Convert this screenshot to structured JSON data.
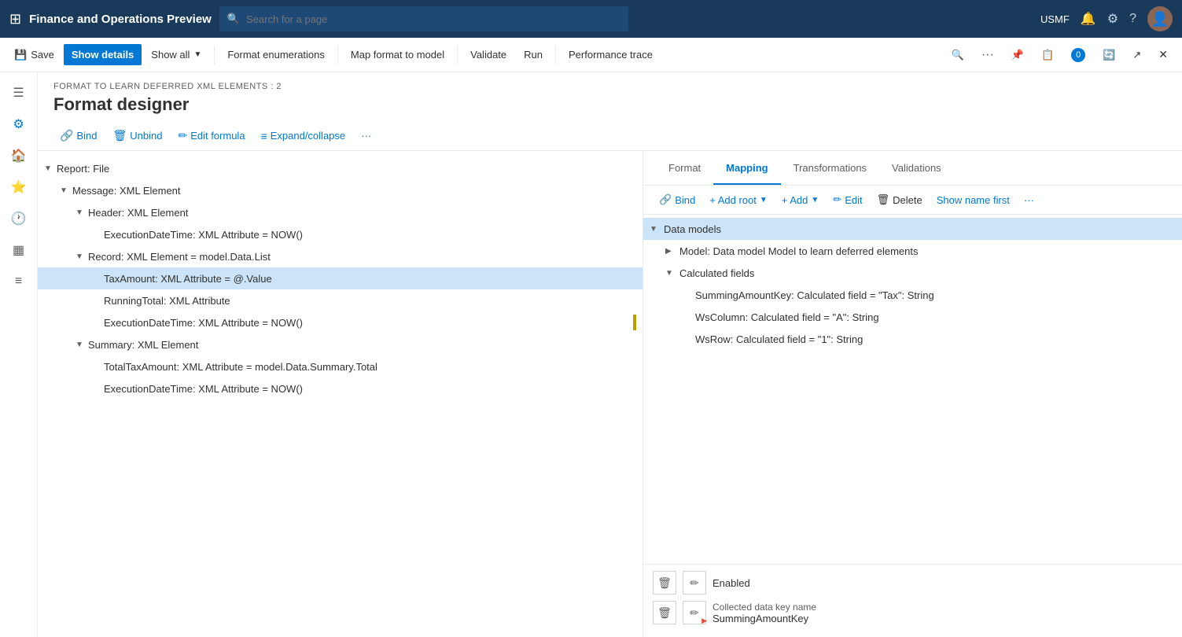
{
  "topbar": {
    "app_title": "Finance and Operations Preview",
    "search_placeholder": "Search for a page",
    "username": "USMF",
    "grid_icon": "⊞",
    "bell_icon": "🔔",
    "gear_icon": "⚙",
    "help_icon": "?",
    "avatar_text": "👤"
  },
  "commandbar": {
    "save_label": "Save",
    "show_details_label": "Show details",
    "show_all_label": "Show all",
    "format_enumerations_label": "Format enumerations",
    "map_format_label": "Map format to model",
    "validate_label": "Validate",
    "run_label": "Run",
    "performance_trace_label": "Performance trace"
  },
  "page": {
    "breadcrumb": "FORMAT TO LEARN DEFERRED XML ELEMENTS : 2",
    "title": "Format designer"
  },
  "designer_toolbar": {
    "bind_label": "Bind",
    "unbind_label": "Unbind",
    "edit_formula_label": "Edit formula",
    "expand_collapse_label": "Expand/collapse",
    "more_label": "···"
  },
  "format_tree": {
    "items": [
      {
        "id": "report-file",
        "indent": 0,
        "toggle": "▼",
        "label": "Report: File",
        "selected": false,
        "has_bar": false
      },
      {
        "id": "message-xml",
        "indent": 1,
        "toggle": "▼",
        "label": "Message: XML Element",
        "selected": false,
        "has_bar": false
      },
      {
        "id": "header-xml",
        "indent": 2,
        "toggle": "▼",
        "label": "Header: XML Element",
        "selected": false,
        "has_bar": false
      },
      {
        "id": "execution-datetime-1",
        "indent": 3,
        "toggle": "",
        "label": "ExecutionDateTime: XML Attribute = NOW()",
        "selected": false,
        "has_bar": false
      },
      {
        "id": "record-xml",
        "indent": 2,
        "toggle": "▼",
        "label": "Record: XML Element = model.Data.List",
        "selected": false,
        "has_bar": false
      },
      {
        "id": "taxamount",
        "indent": 3,
        "toggle": "",
        "label": "TaxAmount: XML Attribute = @.Value",
        "selected": true,
        "has_bar": false
      },
      {
        "id": "runningtotal",
        "indent": 3,
        "toggle": "",
        "label": "RunningTotal: XML Attribute",
        "selected": false,
        "has_bar": false
      },
      {
        "id": "execution-datetime-2",
        "indent": 3,
        "toggle": "",
        "label": "ExecutionDateTime: XML Attribute = NOW()",
        "selected": false,
        "has_bar": true
      },
      {
        "id": "summary-xml",
        "indent": 2,
        "toggle": "▼",
        "label": "Summary: XML Element",
        "selected": false,
        "has_bar": false
      },
      {
        "id": "totaltaxamount",
        "indent": 3,
        "toggle": "",
        "label": "TotalTaxAmount: XML Attribute = model.Data.Summary.Total",
        "selected": false,
        "has_bar": false
      },
      {
        "id": "execution-datetime-3",
        "indent": 3,
        "toggle": "",
        "label": "ExecutionDateTime: XML Attribute = NOW()",
        "selected": false,
        "has_bar": false
      }
    ]
  },
  "panel_tabs": {
    "format_label": "Format",
    "mapping_label": "Mapping",
    "transformations_label": "Transformations",
    "validations_label": "Validations"
  },
  "panel_toolbar": {
    "bind_label": "Bind",
    "add_root_label": "+ Add root",
    "add_label": "+ Add",
    "edit_label": "Edit",
    "delete_label": "Delete",
    "show_name_first_label": "Show name first",
    "more_label": "···"
  },
  "mapping_tree": {
    "items": [
      {
        "id": "data-models",
        "indent": 0,
        "toggle": "▼",
        "label": "Data models",
        "selected": true
      },
      {
        "id": "model-item",
        "indent": 1,
        "toggle": "▶",
        "label": "Model: Data model Model to learn deferred elements",
        "selected": false
      },
      {
        "id": "calculated-fields",
        "indent": 1,
        "toggle": "▼",
        "label": "Calculated fields",
        "selected": false
      },
      {
        "id": "summing-amount",
        "indent": 2,
        "toggle": "",
        "label": "SummingAmountKey: Calculated field = \"Tax\": String",
        "selected": false
      },
      {
        "id": "ws-column",
        "indent": 2,
        "toggle": "",
        "label": "WsColumn: Calculated field = \"A\": String",
        "selected": false
      },
      {
        "id": "ws-row",
        "indent": 2,
        "toggle": "",
        "label": "WsRow: Calculated field = \"1\": String",
        "selected": false
      }
    ]
  },
  "bottom_panel": {
    "row1": {
      "label": "Enabled",
      "delete_icon": "🗑",
      "edit_icon": "✏"
    },
    "row2": {
      "label": "Collected data key name",
      "value": "SummingAmountKey",
      "delete_icon": "🗑",
      "edit_icon": "✏"
    }
  }
}
